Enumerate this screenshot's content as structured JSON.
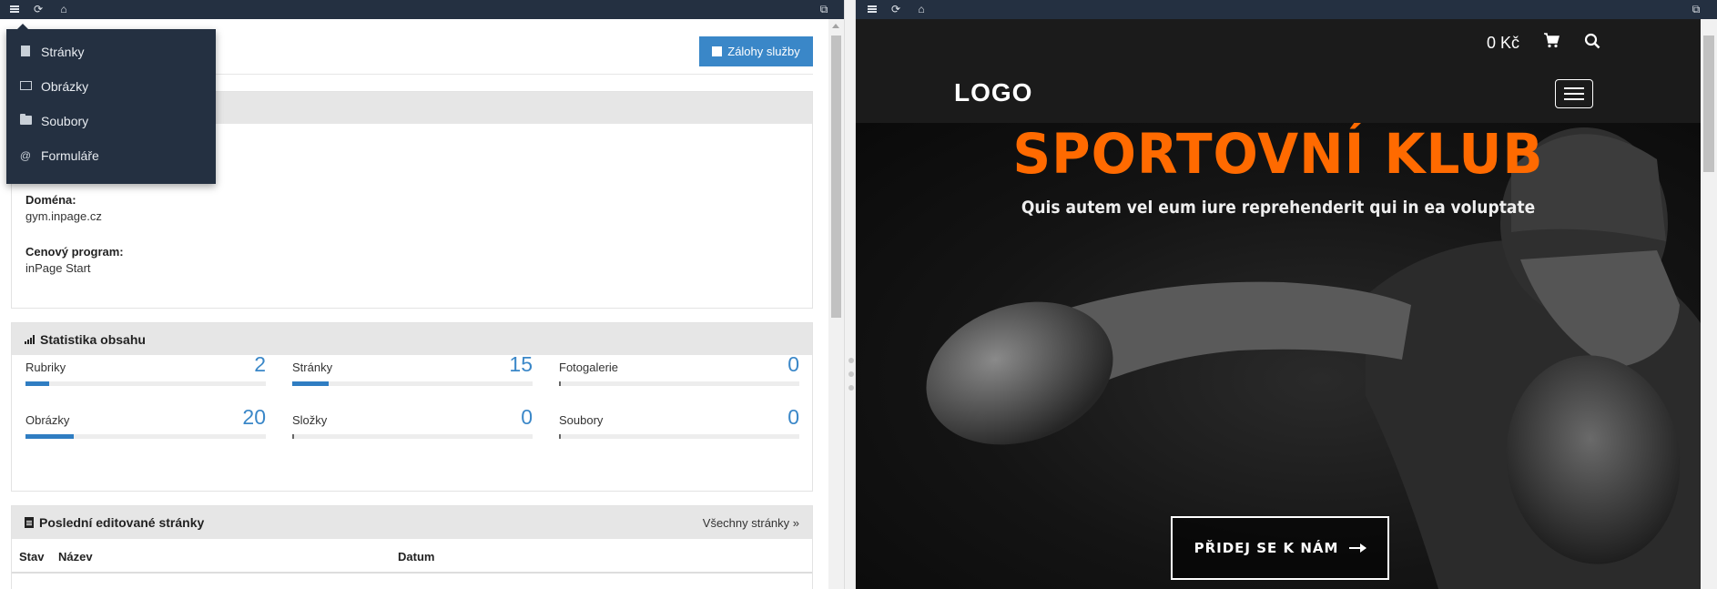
{
  "left_toolbar": {
    "icons": [
      "menu-icon",
      "refresh-icon",
      "home-icon",
      "popout-icon"
    ]
  },
  "dropdown_menu": {
    "items": [
      {
        "label": "Stránky",
        "icon": "file-icon"
      },
      {
        "label": "Obrázky",
        "icon": "image-icon"
      },
      {
        "label": "Soubory",
        "icon": "folder-icon"
      },
      {
        "label": "Formuláře",
        "icon": "at-icon"
      }
    ]
  },
  "header": {
    "backup_button": "Zálohy služby"
  },
  "site_info": {
    "domain_label": "Doména:",
    "domain_value": "gym.inpage.cz",
    "plan_label": "Cenový program:",
    "plan_value": "inPage Start"
  },
  "stats": {
    "title": "Statistika obsahu",
    "items": [
      {
        "label": "Rubriky",
        "value": "2",
        "fill": 0.1
      },
      {
        "label": "Stránky",
        "value": "15",
        "fill": 0.15
      },
      {
        "label": "Fotogalerie",
        "value": "0",
        "fill": 0
      },
      {
        "label": "Obrázky",
        "value": "20",
        "fill": 0.2
      },
      {
        "label": "Složky",
        "value": "0",
        "fill": 0
      },
      {
        "label": "Soubory",
        "value": "0",
        "fill": 0
      }
    ]
  },
  "recent": {
    "title": "Poslední editované stránky",
    "all_link": "Všechny stránky »",
    "columns": [
      "Stav",
      "Název",
      "Datum"
    ]
  },
  "right_toolbar": {
    "icons": [
      "menu-icon",
      "refresh-icon",
      "home-icon",
      "popout-icon"
    ]
  },
  "site": {
    "price": "0 Kč",
    "logo": "LOGO",
    "hero_title": "SPORTOVNÍ KLUB",
    "hero_subtitle": "Quis autem vel eum iure reprehenderit qui in ea voluptate",
    "cta": "PŘIDEJ SE K NÁM"
  },
  "colors": {
    "accent": "#3a87c8",
    "toolbar": "#243041",
    "hero_title": "#ff6a00"
  }
}
